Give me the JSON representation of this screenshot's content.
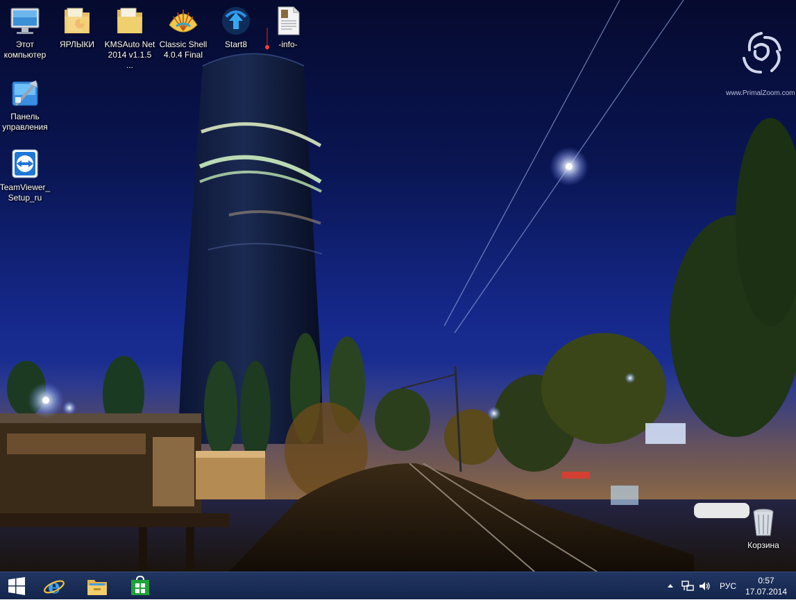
{
  "desktop": {
    "icons": [
      {
        "name": "this-pc",
        "label": "Этот\nкомпьютер"
      },
      {
        "name": "shortcuts-folder",
        "label": "ЯРЛЫКИ"
      },
      {
        "name": "kmsauto-folder",
        "label": "KMSAuto Net\n2014 v1.1.5 ..."
      },
      {
        "name": "classic-shell",
        "label": "Classic Shell\n4.0.4 Final"
      },
      {
        "name": "start8",
        "label": "Start8"
      },
      {
        "name": "info-file",
        "label": "-info-"
      },
      {
        "name": "control-panel",
        "label": "Панель\nуправления"
      },
      {
        "name": "teamviewer-setup",
        "label": "TeamViewer_\nSetup_ru"
      },
      {
        "name": "recycle-bin",
        "label": "Корзина"
      }
    ]
  },
  "wallpaper": {
    "watermark": "www.PrimalZoom.com"
  },
  "taskbar": {
    "pinned": [
      {
        "name": "start",
        "icon": "windows-logo-icon"
      },
      {
        "name": "internet-explorer",
        "icon": "ie-icon"
      },
      {
        "name": "file-explorer",
        "icon": "folder-icon"
      },
      {
        "name": "store",
        "icon": "store-icon"
      }
    ],
    "tray": {
      "language": "РУС",
      "time": "0:57",
      "date": "17.07.2014"
    }
  },
  "colors": {
    "taskbar": "#14295c",
    "sky_top": "#050a2e",
    "sky_mid": "#15288a",
    "accent_blue": "#1e7ad6"
  }
}
